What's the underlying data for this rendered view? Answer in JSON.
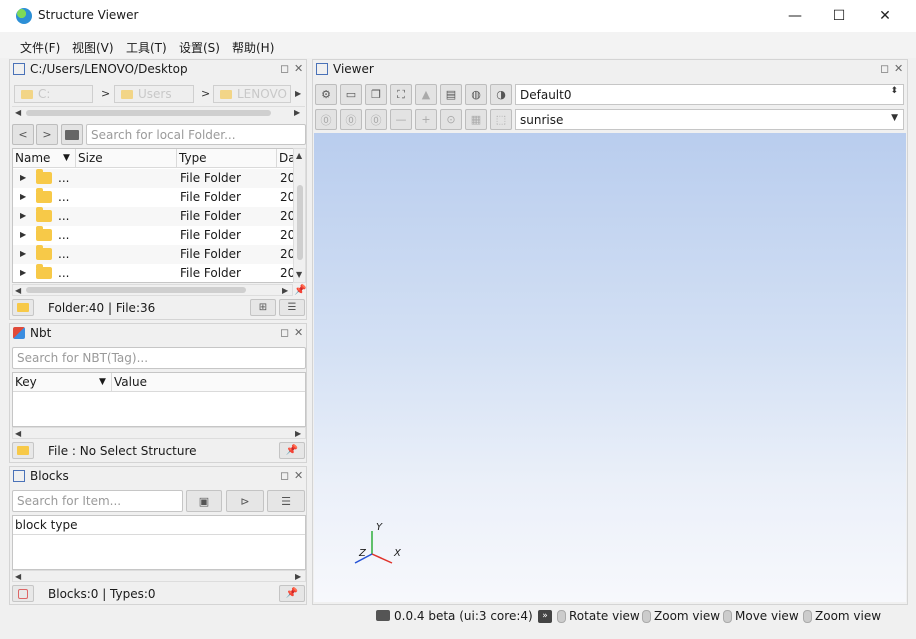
{
  "window": {
    "title": "Structure Viewer",
    "min": "—",
    "max": "☐",
    "close": "✕"
  },
  "menu": [
    "文件(F)",
    "视图(V)",
    "工具(T)",
    "设置(S)",
    "帮助(H)"
  ],
  "explorer": {
    "path": "C:/Users/LENOVO/Desktop",
    "breadcrumbs": [
      "C:",
      "Users",
      "LENOVO"
    ],
    "search_placeholder": "Search for local Folder...",
    "columns": [
      "Name",
      "Size",
      "Type",
      "Da"
    ],
    "rows": [
      {
        "name": "...",
        "type": "File Folder",
        "date": "20"
      },
      {
        "name": "...",
        "type": "File Folder",
        "date": "20"
      },
      {
        "name": "...",
        "type": "File Folder",
        "date": "20"
      },
      {
        "name": "...",
        "type": "File Folder",
        "date": "20"
      },
      {
        "name": "...",
        "type": "File Folder",
        "date": "20"
      },
      {
        "name": "...",
        "type": "File Folder",
        "date": "20"
      }
    ],
    "status": "Folder:40 | File:36"
  },
  "nbt": {
    "title": "Nbt",
    "search_placeholder": "Search for NBT(Tag)...",
    "columns": [
      "Key",
      "Value"
    ],
    "status": "File : No Select Structure"
  },
  "blocks": {
    "title": "Blocks",
    "search_placeholder": "Search for Item...",
    "columns": [
      "block type"
    ],
    "status": "Blocks:0 | Types:0"
  },
  "viewer": {
    "title": "Viewer",
    "camera": "Default0",
    "environment": "sunrise",
    "axes": {
      "x": "X",
      "y": "Y",
      "z": "Z"
    }
  },
  "statusbar": {
    "version": "0.0.4 beta (ui:3 core:4)",
    "hints": [
      "Rotate view",
      "Zoom view",
      "Move view",
      "Zoom view"
    ]
  },
  "colors": {
    "folder": "#f7c948",
    "canvas_top": "#b9cdee",
    "canvas_bottom": "#f7f8fc",
    "axis_x": "#e0322a",
    "axis_y": "#2fae3b",
    "axis_z": "#2452d6"
  }
}
